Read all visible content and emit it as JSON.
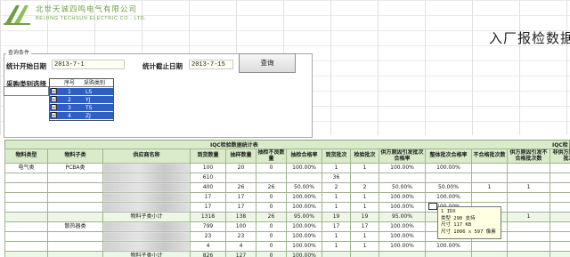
{
  "header": {
    "logo_cn": "北世天诚四鸣电气有限公司",
    "logo_en": "BEIJING TECHSUN ELECTRIC CO., LTD.",
    "page_title": "入厂报检数据"
  },
  "query": {
    "group_label": "查询条件",
    "start_label": "统计开始日期",
    "start_value": "2013-7-1",
    "end_label": "统计截止日期",
    "end_value": "2013-7-15",
    "button_label": "查询",
    "purchase_label": "采购类别选择",
    "listbox": {
      "col_seq": "序号",
      "col_cat": "采购类别",
      "rows": [
        {
          "seq": "1",
          "cat": "LS",
          "checked": "☑"
        },
        {
          "seq": "2",
          "cat": "YJ",
          "checked": "☑"
        },
        {
          "seq": "3",
          "cat": "TS",
          "checked": "☑"
        },
        {
          "seq": "4",
          "cat": "ZJ",
          "checked": "☑"
        }
      ]
    }
  },
  "report": {
    "title": "IQC检验数据统计表",
    "title2": "IQC检",
    "headers": [
      "物料类型",
      "物料子类",
      "供应商名称",
      "到货数量",
      "抽样数量",
      "抽检不良数量",
      "抽检合格率",
      "到货批次",
      "检验批次",
      "供方原因引发批次合格率",
      "整体批次合格率",
      "不合格批次数",
      "供方原因引发不合格批次数",
      "非供方原因引发批次数"
    ],
    "rows": [
      {
        "type": "电气类",
        "sub": "PCBA类",
        "supplier": "■■■■",
        "arr": "100",
        "sample": "20",
        "bad": "0",
        "rate": "100.00%",
        "batch": "1",
        "insp": "1",
        "sup_rate": "100.00%",
        "all_rate": "100.00%",
        "ng": "",
        "sup_ng": "",
        "non_sup": ""
      },
      {
        "type": "",
        "sub": "",
        "supplier": "■■■■",
        "arr": "610",
        "sample": "",
        "bad": "",
        "rate": "",
        "batch": "36",
        "insp": "",
        "sup_rate": "",
        "all_rate": "",
        "ng": "",
        "sup_ng": "",
        "non_sup": ""
      },
      {
        "type": "",
        "sub": "",
        "supplier": "■■■■",
        "arr": "400",
        "sample": "26",
        "bad": "26",
        "rate": "50.00%",
        "batch": "2",
        "insp": "2",
        "sup_rate": "50.00%",
        "all_rate": "50.00%",
        "ng": "1",
        "sup_ng": "1",
        "non_sup": ""
      },
      {
        "type": "",
        "sub": "",
        "supplier": "■■■■",
        "arr": "17",
        "sample": "17",
        "bad": "0",
        "rate": "100.00%",
        "batch": "1",
        "insp": "1",
        "sup_rate": "100.00%",
        "all_rate": "100.00%",
        "ng": "",
        "sup_ng": "",
        "non_sup": ""
      },
      {
        "type": "",
        "sub": "",
        "supplier": "■■■■",
        "arr": "17",
        "sample": "17",
        "bad": "0",
        "rate": "100.00%",
        "batch": "1",
        "insp": "1",
        "sup_rate": "100.00%",
        "all_rate": "100.00%",
        "ng": "",
        "sup_ng": "",
        "non_sup": ""
      },
      {
        "type": "",
        "sub": "",
        "supplier": "物料子类小计",
        "arr": "1318",
        "sample": "138",
        "bad": "26",
        "rate": "95.00%",
        "batch": "19",
        "insp": "19",
        "sup_rate": "95.00%",
        "all_rate": "95.00%",
        "ng": "1",
        "sup_ng": "1",
        "non_sup": "",
        "subtotal": true
      },
      {
        "type": "",
        "sub": "散热器类",
        "supplier": "■■■■",
        "arr": "799",
        "sample": "100",
        "bad": "0",
        "rate": "100.00%",
        "batch": "17",
        "insp": "17",
        "sup_rate": "100.00%",
        "all_rate": "100.00%",
        "ng": "",
        "sup_ng": "",
        "non_sup": ""
      },
      {
        "type": "",
        "sub": "",
        "supplier": "■■■■",
        "arr": "23",
        "sample": "23",
        "bad": "0",
        "rate": "100.00%",
        "batch": "1",
        "insp": "1",
        "sup_rate": "100.00%",
        "all_rate": "100.00%",
        "ng": "",
        "sup_ng": "",
        "non_sup": ""
      },
      {
        "type": "",
        "sub": "",
        "supplier": "■■■■",
        "arr": "4",
        "sample": "4",
        "bad": "0",
        "rate": "100.00%",
        "batch": "1",
        "insp": "1",
        "sup_rate": "100.00%",
        "all_rate": "100.00%",
        "ng": "",
        "sup_ng": "",
        "non_sup": ""
      },
      {
        "type": "",
        "sub": "",
        "supplier": "物料子类小计",
        "arr": "826",
        "sample": "127",
        "bad": "0",
        "rate": "100.00%",
        "batch": "",
        "insp": "",
        "sup_rate": "",
        "all_rate": "",
        "ng": "",
        "sup_ng": "",
        "non_sup": "",
        "subtotal": true
      }
    ]
  },
  "tooltip": {
    "line1": "1 IDX",
    "line2": "类型  290 支持",
    "line3": "尺寸  117 KB",
    "line4": "尺寸  1096 x 597 像素"
  }
}
